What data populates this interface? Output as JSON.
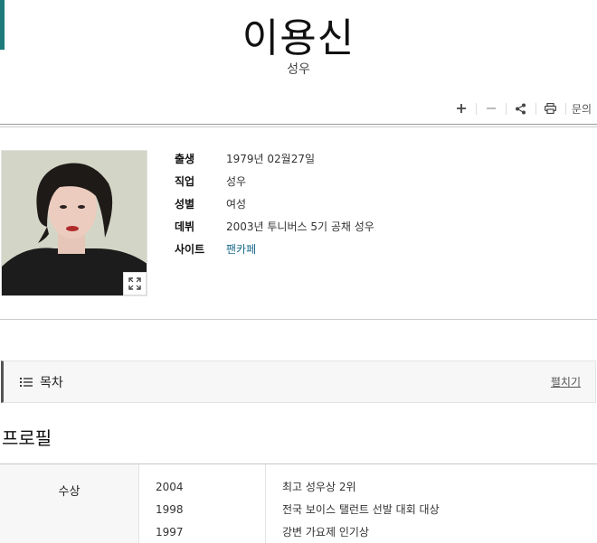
{
  "page": {
    "title": "이용신",
    "subtitle": "성우"
  },
  "toolbar": {
    "buttons": [
      "plus-icon",
      "minus-icon",
      "share-icon",
      "print-icon"
    ],
    "inquiry_label": "문의"
  },
  "profile": {
    "rows": [
      {
        "label": "출생",
        "value": "1979년 02월27일"
      },
      {
        "label": "직업",
        "value": "성우"
      },
      {
        "label": "성별",
        "value": "여성"
      },
      {
        "label": "데뷔",
        "value": "2003년 투니버스 5기 공채 성우"
      },
      {
        "label": "사이트",
        "value": "팬카페"
      }
    ]
  },
  "toc": {
    "title": "목차",
    "toggle_label": "펼치기"
  },
  "section": {
    "title": "프로필"
  },
  "awards": {
    "label": "수상",
    "items": [
      {
        "year": "2004",
        "name": "최고 성우상 2위"
      },
      {
        "year": "1998",
        "name": "전국 보이스 탤런트 선발 대회 대상"
      },
      {
        "year": "1997",
        "name": "강변 가요제 인기상"
      }
    ]
  },
  "colors": {
    "accent": "#1d7a7a",
    "link": "#1a6a8a"
  }
}
